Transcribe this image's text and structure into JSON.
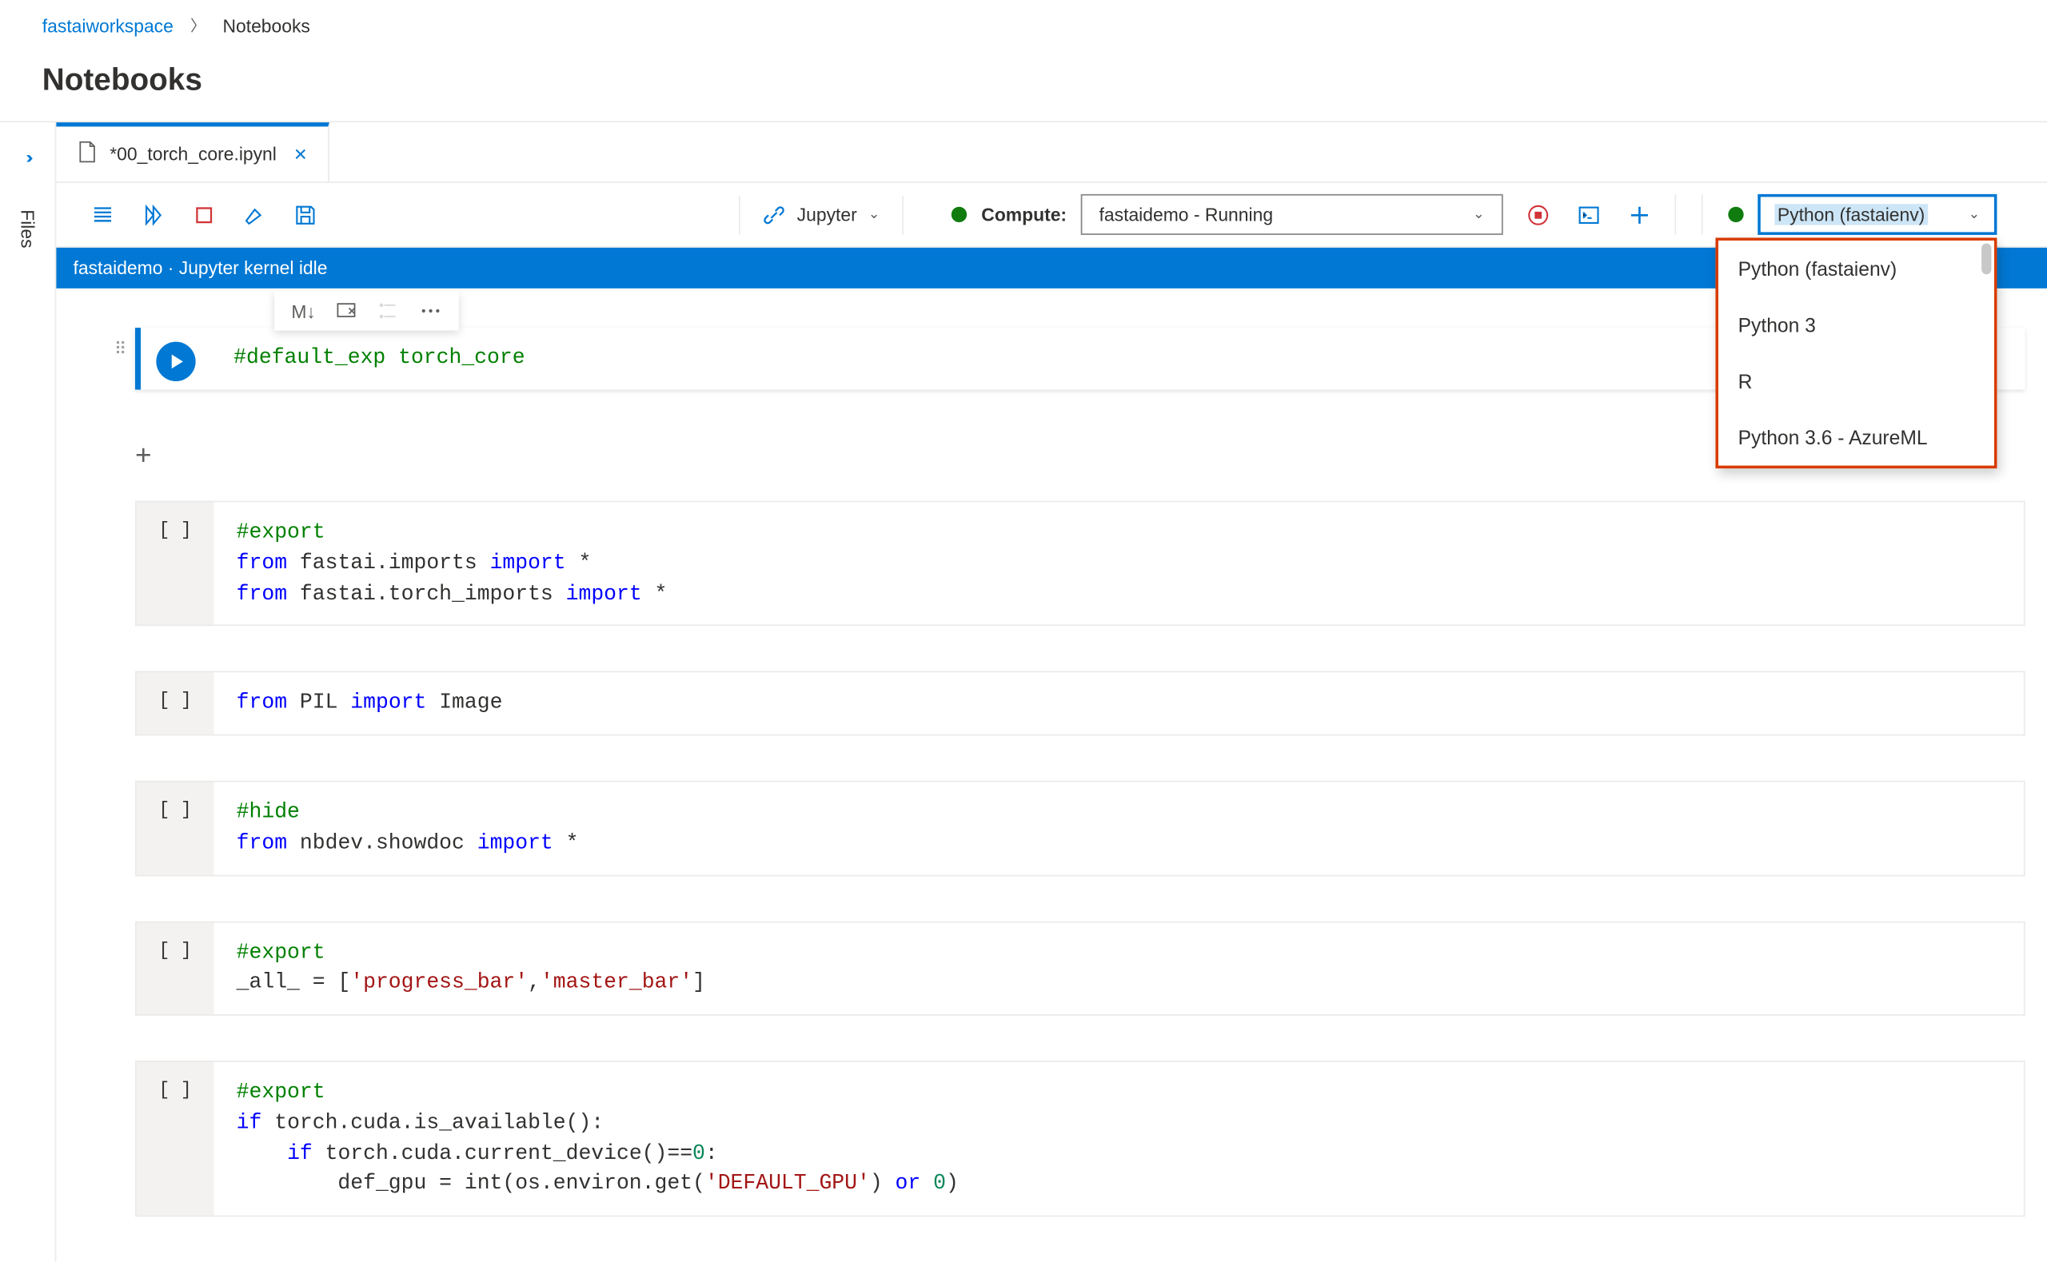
{
  "breadcrumb": {
    "parent": "fastaiworkspace",
    "current": "Notebooks"
  },
  "page_title": "Notebooks",
  "sidebar": {
    "files_label": "Files"
  },
  "tab": {
    "filename": "*00_torch_core.ipynl"
  },
  "toolbar": {
    "jupyter_label": "Jupyter",
    "compute_label": "Compute:",
    "compute_selected": "fastaidemo   -   Running"
  },
  "kernel": {
    "selected": "Python (fastaienv)",
    "options": [
      "Python (fastaienv)",
      "Python 3",
      "R",
      "Python 3.6 - AzureML"
    ]
  },
  "status_bar": "fastaidemo · Jupyter kernel idle",
  "cell_toolbar": {
    "markdown": "M↓"
  },
  "cells": [
    {
      "prompt": "",
      "active": true,
      "code_html": "<span class='c-comment'>#default_exp torch_core</span>"
    },
    {
      "prompt": "[ ]",
      "code_html": "<span class='c-comment'>#export</span>\n<span class='c-keyword'>from</span> fastai.imports <span class='c-keyword'>import</span> *\n<span class='c-keyword'>from</span> fastai.torch_imports <span class='c-keyword'>import</span> *"
    },
    {
      "prompt": "[ ]",
      "code_html": "<span class='c-keyword'>from</span> PIL <span class='c-keyword'>import</span> Image"
    },
    {
      "prompt": "[ ]",
      "code_html": "<span class='c-comment'>#hide</span>\n<span class='c-keyword'>from</span> nbdev.showdoc <span class='c-keyword'>import</span> *"
    },
    {
      "prompt": "[ ]",
      "code_html": "<span class='c-comment'>#export</span>\n_all_ = [<span class='c-string'>'progress_bar'</span>,<span class='c-string'>'master_bar'</span>]"
    },
    {
      "prompt": "[ ]",
      "code_html": "<span class='c-comment'>#export</span>\n<span class='c-keyword'>if</span> torch.cuda.is_available():\n    <span class='c-keyword'>if</span> torch.cuda.current_device()==<span class='c-num'>0</span>:\n        def_gpu = int(os.environ.get(<span class='c-string'>'DEFAULT_GPU'</span>) <span class='c-keyword'>or</span> <span class='c-num'>0</span>)"
    }
  ]
}
